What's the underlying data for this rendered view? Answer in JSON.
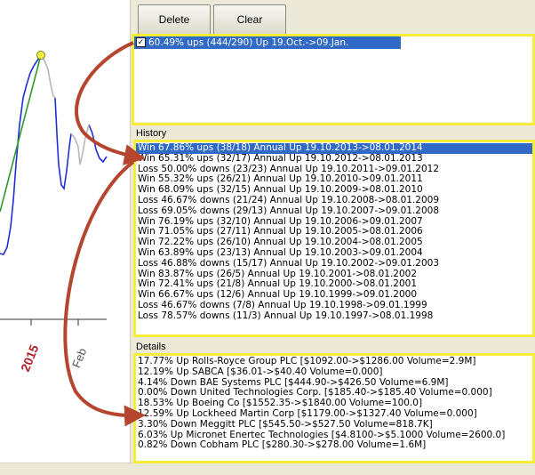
{
  "toolbar": {
    "delete_label": "Delete",
    "clear_label": "Clear"
  },
  "selection": {
    "checked": true,
    "check_mark": "✓",
    "text": "60.49% ups (444/290) Up 19.Oct.->09.Jan."
  },
  "history": {
    "label": "History",
    "rows": [
      "Win 67.86% ups (38/18) Annual Up 19.10.2013->08.01.2014",
      "Win 65.31% ups (32/17) Annual Up 19.10.2012->08.01.2013",
      "Loss 50.00% downs (23/23) Annual Up 19.10.2011->09.01.2012",
      "Win 55.32% ups (26/21) Annual Up 19.10.2010->09.01.2011",
      "Win 68.09% ups (32/15) Annual Up 19.10.2009->08.01.2010",
      "Loss 46.67% downs (21/24) Annual Up 19.10.2008->08.01.2009",
      "Loss 69.05% downs (29/13) Annual Up 19.10.2007->09.01.2008",
      "Win 76.19% ups (32/10) Annual Up 19.10.2006->09.01.2007",
      "Win 71.05% ups (27/11) Annual Up 19.10.2005->08.01.2006",
      "Win 72.22% ups (26/10) Annual Up 19.10.2004->08.01.2005",
      "Win 63.89% ups (23/13) Annual Up 19.10.2003->09.01.2004",
      "Loss 46.88% downs (15/17) Annual Up 19.10.2002->09.01.2003",
      "Win 83.87% ups (26/5) Annual Up 19.10.2001->08.01.2002",
      "Win 72.41% ups (21/8) Annual Up 19.10.2000->08.01.2001",
      "Win 66.67% ups (12/6) Annual Up 19.10.1999->09.01.2000",
      "Loss 46.67% downs (7/8) Annual Up 19.10.1998->09.01.1999",
      "Loss 78.57% downs (11/3) Annual Up 19.10.1997->08.01.1998"
    ]
  },
  "details": {
    "label": "Details",
    "rows": [
      "17.77% Up Rolls-Royce Group PLC [$1092.00->$1286.00  Volume=2.9M]",
      "12.19% Up SABCA [$36.01->$40.40  Volume=0.000]",
      "4.14% Down BAE Systems PLC [$444.90->$426.50  Volume=6.9M]",
      "0.00% Down United Technologies Corp. [$185.40->$185.40  Volume=0.000]",
      "18.53% Up Boeing Co [$1552.35->$1840.00  Volume=100.0]",
      "12.59% Up Lockheed Martin Corp [$1179.00->$1327.40  Volume=0.000]",
      "3.30% Down Meggitt PLC [$545.50->$527.50  Volume=818.7K]",
      "6.03% Up Micronet Enertec Technologies [$4.8100->$5.1000  Volume=2600.0]",
      "0.82% Down Cobham PLC [$280.30->$278.00  Volume=1.6M]"
    ]
  },
  "chart": {
    "x_labels": [
      {
        "text": "2015",
        "color": "#b3202a"
      },
      {
        "text": "Feb",
        "color": "#555555"
      }
    ]
  },
  "colors": {
    "arrow": "#b5452f",
    "highlight_frame": "#f6ed3a",
    "selection": "#3169c6",
    "line_blue": "#1f2fd6",
    "line_green": "#2c9a2c"
  }
}
